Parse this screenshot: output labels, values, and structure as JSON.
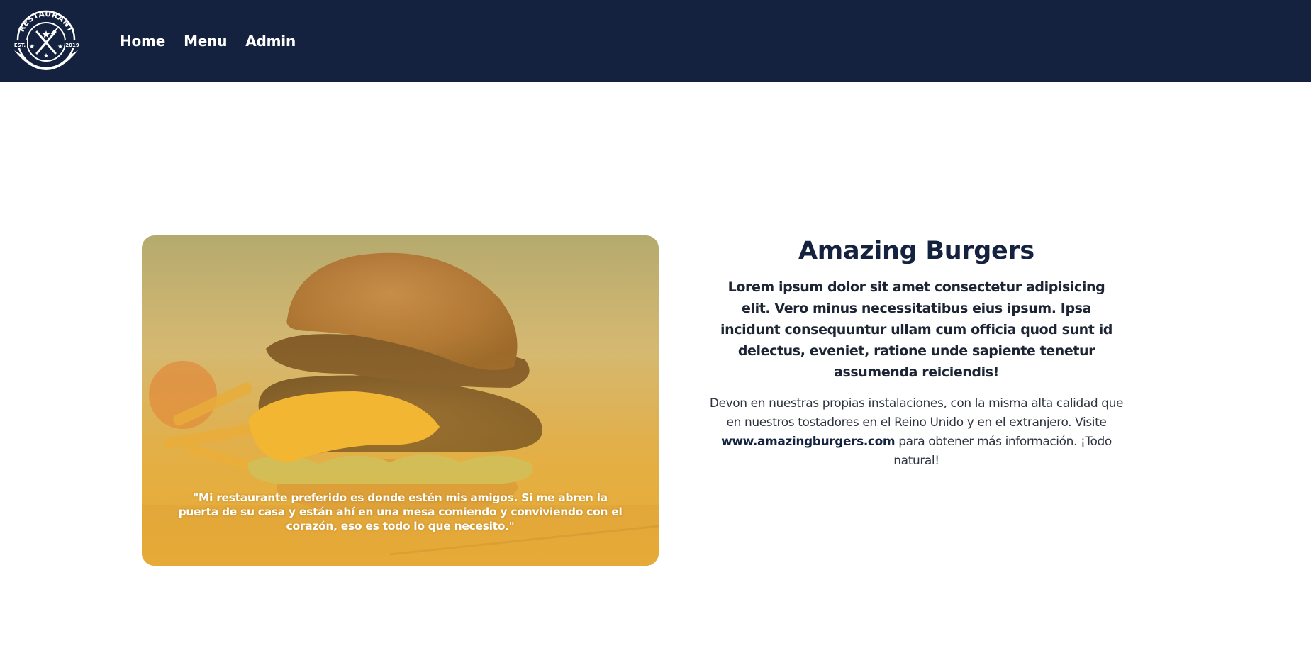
{
  "logo": {
    "text": "RESTAURANT",
    "est": "EST.",
    "year": "2019"
  },
  "nav": {
    "items": [
      {
        "label": "Home"
      },
      {
        "label": "Menu"
      },
      {
        "label": "Admin"
      }
    ]
  },
  "hero": {
    "quote": "\"Mi restaurante preferido es donde estén mis amigos. Si me abren la puerta de su casa y están ahí en una mesa comiendo y conviviendo con el corazón, eso es todo lo que necesito.\""
  },
  "info": {
    "title": "Amazing Burgers",
    "lead": "Lorem ipsum dolor sit amet consectetur adipisicing elit. Vero minus necessitatibus eius ipsum. Ipsa incidunt consequuntur ullam cum officia quod sunt id delectus, eveniet, ratione unde sapiente tenetur assumenda reiciendis!",
    "desc_before": "Devon en nuestras propias instalaciones, con la misma alta calidad que en nuestros tostadores en el Reino Unido y en el extranjero. Visite",
    "desc_link": "www.amazingburgers.com",
    "desc_after": "para obtener más información. ¡Todo natural!"
  },
  "colors": {
    "navbar": "#15223f",
    "title": "#15223f",
    "overlay": "#f3b733"
  }
}
